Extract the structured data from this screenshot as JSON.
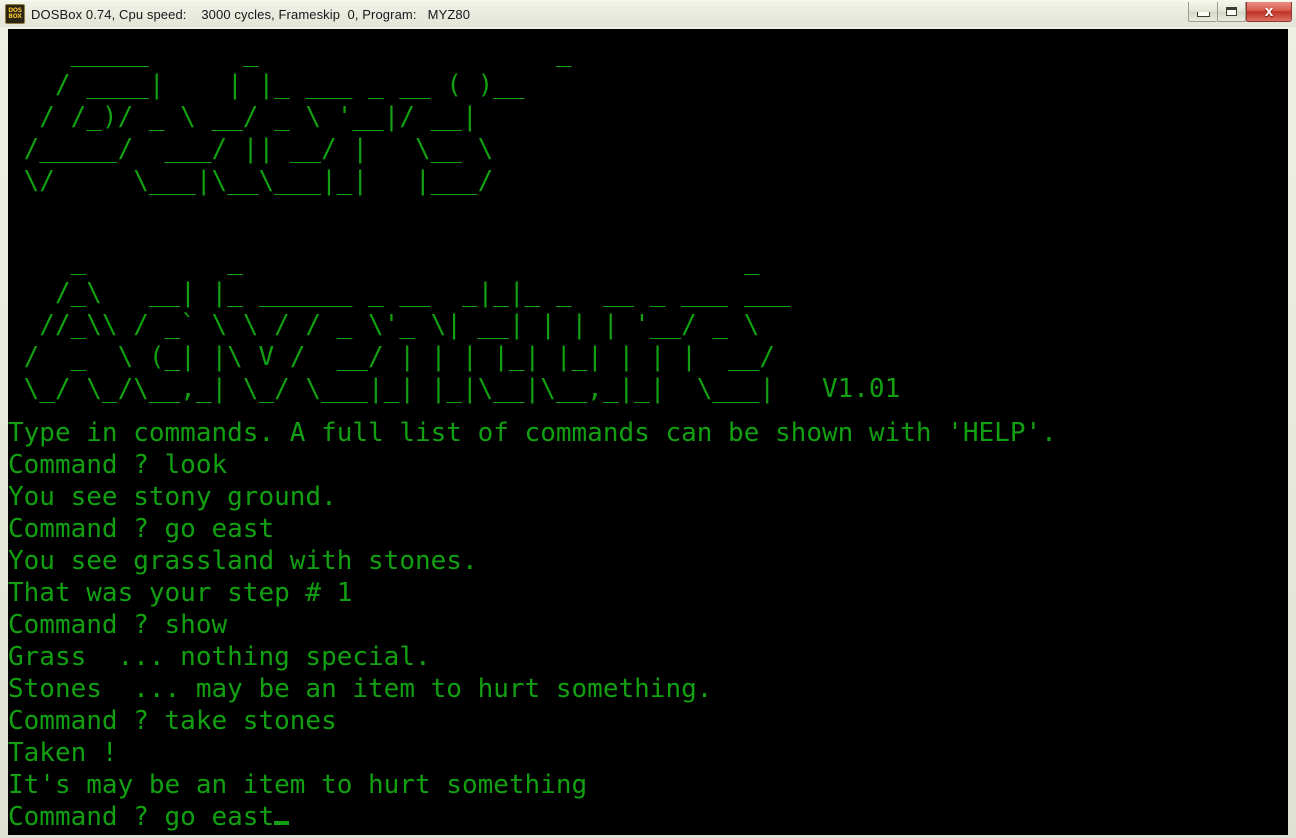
{
  "window": {
    "title": "DOSBox 0.74, Cpu speed:    3000 cycles, Frameskip  0, Program:   MYZ80",
    "icon_label_top": "DOS",
    "icon_label_bottom": "BOX",
    "controls": {
      "minimize": "minimize",
      "maximize": "maximize",
      "close": "x"
    }
  },
  "dosbox": {
    "version": "0.74",
    "cpu_speed": "3000 cycles",
    "frameskip": "0",
    "program": "MYZ80"
  },
  "screen": {
    "background": "#000000",
    "foreground": "#12a012",
    "columns": 80,
    "rows": 25
  },
  "banner": {
    "line1": [
      "    _____      _                   _                      ",
      "   / ____|    | |_ ___ _ __ ( )__              ",
      "  / /_)/ _ \\ __/ _ \\ '__|/ __|             ",
      " /_____/  ___/ || __/ |   \\__ \\            ",
      " \\/     \\___|\\__\\___|_|   |___/            "
    ],
    "line2": [
      "    _         _                                _                     ",
      "   /_\\   __| |_ ______ _ __  _|_|_ _  __ _ ___ ___      ",
      "  //_\\\\ / _` \\ \\ / / _ \\'_ \\| __| | | | '__/ _ \\     ",
      " /  _  \\ (_| |\\ V /  __/ | | | |_| |_| | | |  __/     ",
      " \\_/ \\_/\\__,_| \\_/ \\___|_| |_|\\__|\\__,_|_|  \\___|   V1.01"
    ],
    "version_label": "V1.01"
  },
  "terminal_lines": [
    "Type in commands. A full list of commands can be shown with 'HELP'.",
    "Command ? look",
    "You see stony ground.",
    "Command ? go east",
    "You see grassland with stones.",
    "That was your step # 1",
    "Command ? show",
    "Grass  ... nothing special.",
    "Stones  ... may be an item to hurt something.",
    "Command ? take stones",
    "Taken !",
    "It's may be an item to hurt something",
    "Command ? go east"
  ],
  "prompt": {
    "label": "Command ?",
    "current_input": "go east",
    "cursor": "_"
  }
}
